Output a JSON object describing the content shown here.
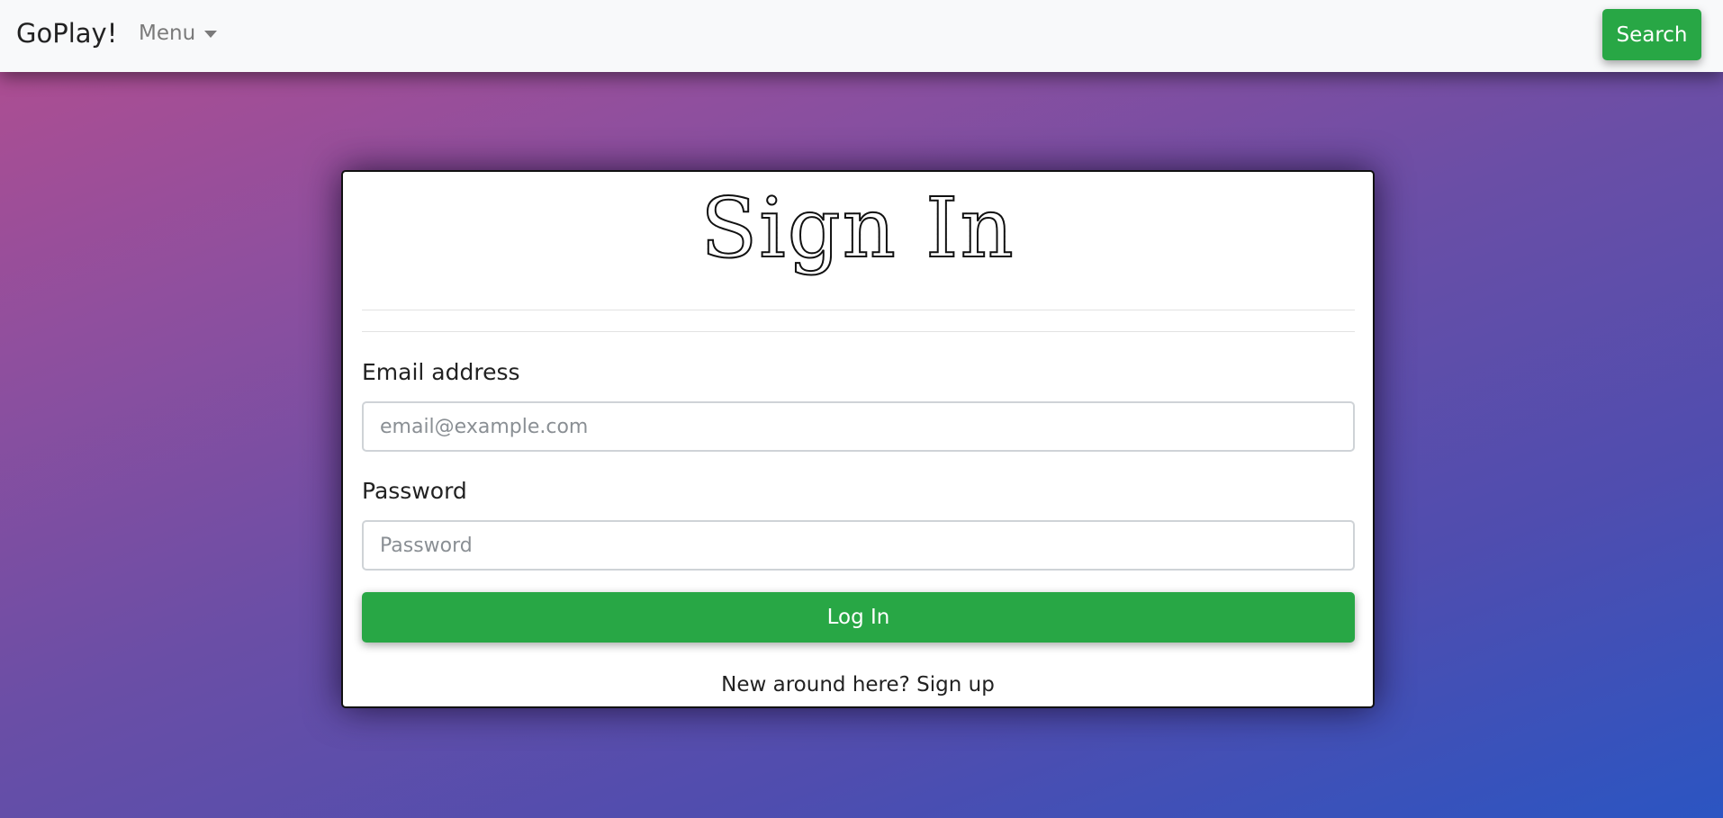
{
  "navbar": {
    "brand": "GoPlay!",
    "menu_label": "Menu",
    "search_label": "Search"
  },
  "card": {
    "title": "Sign In",
    "email": {
      "label": "Email address",
      "placeholder": "email@example.com"
    },
    "password": {
      "label": "Password",
      "placeholder": "Password"
    },
    "login_label": "Log In",
    "signup_prompt": "New around here?",
    "signup_link": "Sign up"
  },
  "colors": {
    "accent_green": "#28a745",
    "navbar_bg": "#f8f9fa",
    "gradient_start": "#b34d8f",
    "gradient_end": "#2b55c2"
  }
}
